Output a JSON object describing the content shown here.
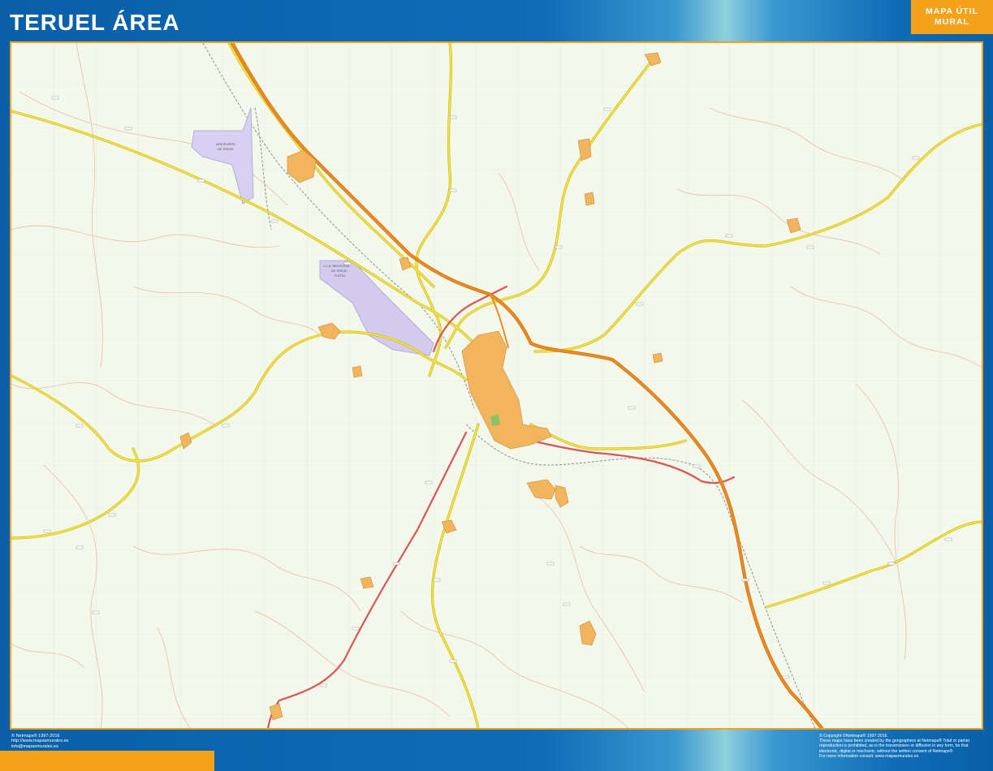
{
  "title": "TERUEL ÁREA",
  "badge": {
    "line1": "MAPA ÚTIL",
    "line2": "MURAL"
  },
  "map": {
    "area_labels": {
      "airport": [
        "AEROPUERTO",
        "DE TERUEL"
      ],
      "industrial": [
        "C.L.A. INDUSTRIAL",
        "DE TERUEL",
        "PLATEA"
      ]
    },
    "colors": {
      "background": "#f3f8ea",
      "motorway": "#f08a1c",
      "national_road": "#d9545b",
      "regional_road": "#f2e23a",
      "urban": "#f2b45c",
      "industrial_area": "#c9c3ea",
      "railway": "#9a9a9a",
      "frame_border": "#f5a21b"
    }
  },
  "footer": {
    "left": [
      "© Netmaps® 1997-2016",
      "http://www.mapasmurales.es",
      "info@mapasmurales.es"
    ],
    "right": [
      "© Copyright ©Netmaps® 1997-2016",
      "These maps have been created by the geographers at Netmaps® Total or partial",
      "reproduction is prohibited, as is the transmission or diffusion in any form, be that",
      "electronic, digital or mechanic; without the written consent of Netmaps®",
      "For more information consult: www.mapasmurales.es"
    ]
  }
}
